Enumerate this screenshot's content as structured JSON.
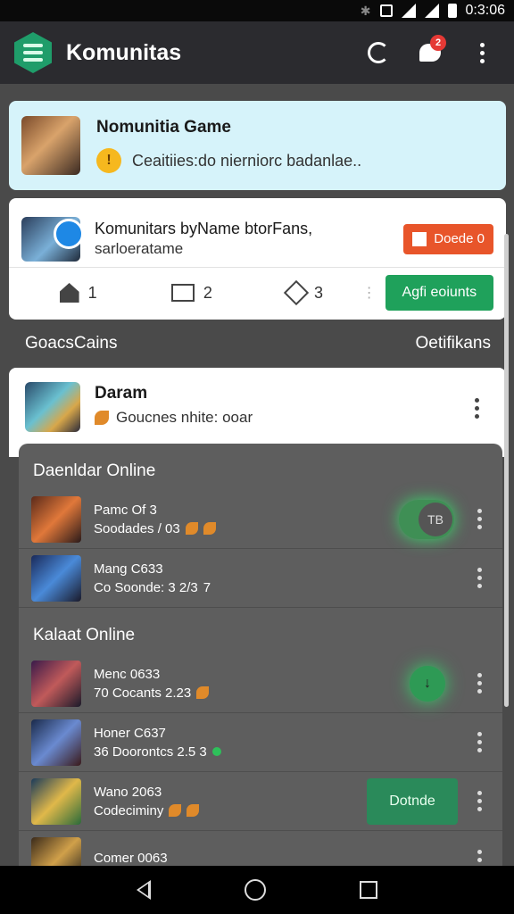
{
  "status": {
    "time": "0:3:06"
  },
  "appbar": {
    "title": "Komunitas",
    "notif_count": "2"
  },
  "top_card": {
    "title": "Nomunitia Game",
    "subtitle": "Ceaitiies:do nierniorc badanlae..",
    "warn_glyph": "!"
  },
  "mid_card": {
    "title": "Komunitars byName btorFans,",
    "subtitle": "sarloeratame",
    "action_label": "Doede 0",
    "stats": [
      {
        "value": "1"
      },
      {
        "value": "2"
      },
      {
        "value": "3"
      }
    ],
    "green_button": "Agfi eoiunts"
  },
  "section": {
    "left": "GoacsCains",
    "right": "Oetifikans"
  },
  "dam_card": {
    "title": "Daram",
    "subtitle": "Goucnes nhite: ooar"
  },
  "overlay": {
    "groups": [
      {
        "heading": "Daenldar Online",
        "rows": [
          {
            "name": "Pamc Of 3",
            "meta": "Soodades / 03",
            "toggle_label": "TB"
          },
          {
            "name": "Mang C633",
            "meta": "Co Soonde: 3 2/3",
            "meta_glyph": "7"
          }
        ]
      },
      {
        "heading": "Kalaat Online",
        "rows": [
          {
            "name": "Menc 0633",
            "meta": "70 Cocants 2.23",
            "action_glyph": "↓"
          },
          {
            "name": "Honer C637",
            "meta": "36 Doorontcs 2.5 3"
          },
          {
            "name": "Wano 2063",
            "meta": "Codeciminy",
            "button_label": "Dotnde"
          },
          {
            "name": "Comer 0063",
            "meta": ""
          }
        ]
      }
    ]
  },
  "colors": {
    "accent_green": "#1fa15b",
    "orange": "#e8552a",
    "top_card_bg": "#d6f3fa",
    "appbar_bg": "#2b2b2f"
  }
}
